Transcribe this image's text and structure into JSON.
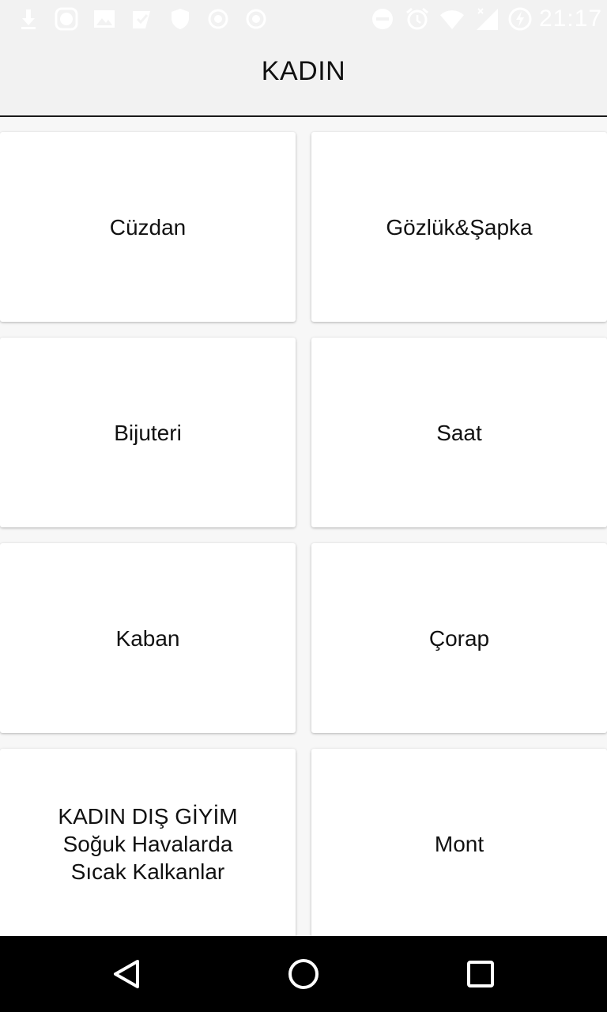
{
  "status_bar": {
    "time": "21:17",
    "left_icons": [
      "download-icon",
      "app-notification-icon",
      "image-icon",
      "checklist-icon",
      "shield-icon",
      "record-icon",
      "record-icon"
    ],
    "right_icons": [
      "do-not-disturb-icon",
      "alarm-icon",
      "wifi-icon",
      "cell-signal-icon",
      "battery-charging-icon"
    ]
  },
  "app_bar": {
    "title": "KADIN"
  },
  "categories": [
    {
      "label": "Cüzdan"
    },
    {
      "label": "Gözlük&Şapka"
    },
    {
      "label": "Bijuteri"
    },
    {
      "label": "Saat"
    },
    {
      "label": "Kaban"
    },
    {
      "label": "Çorap"
    },
    {
      "label": "KADIN DIŞ GİYİM\nSoğuk Havalarda\nSıcak Kalkanlar"
    },
    {
      "label": "Mont"
    }
  ],
  "nav_bar": {
    "buttons": [
      "back-icon",
      "home-icon",
      "recents-icon"
    ]
  },
  "colors": {
    "app_bar_bg": "#f2f2f2",
    "tile_bg": "#ffffff",
    "nav_bg": "#000000",
    "text": "#111111"
  }
}
